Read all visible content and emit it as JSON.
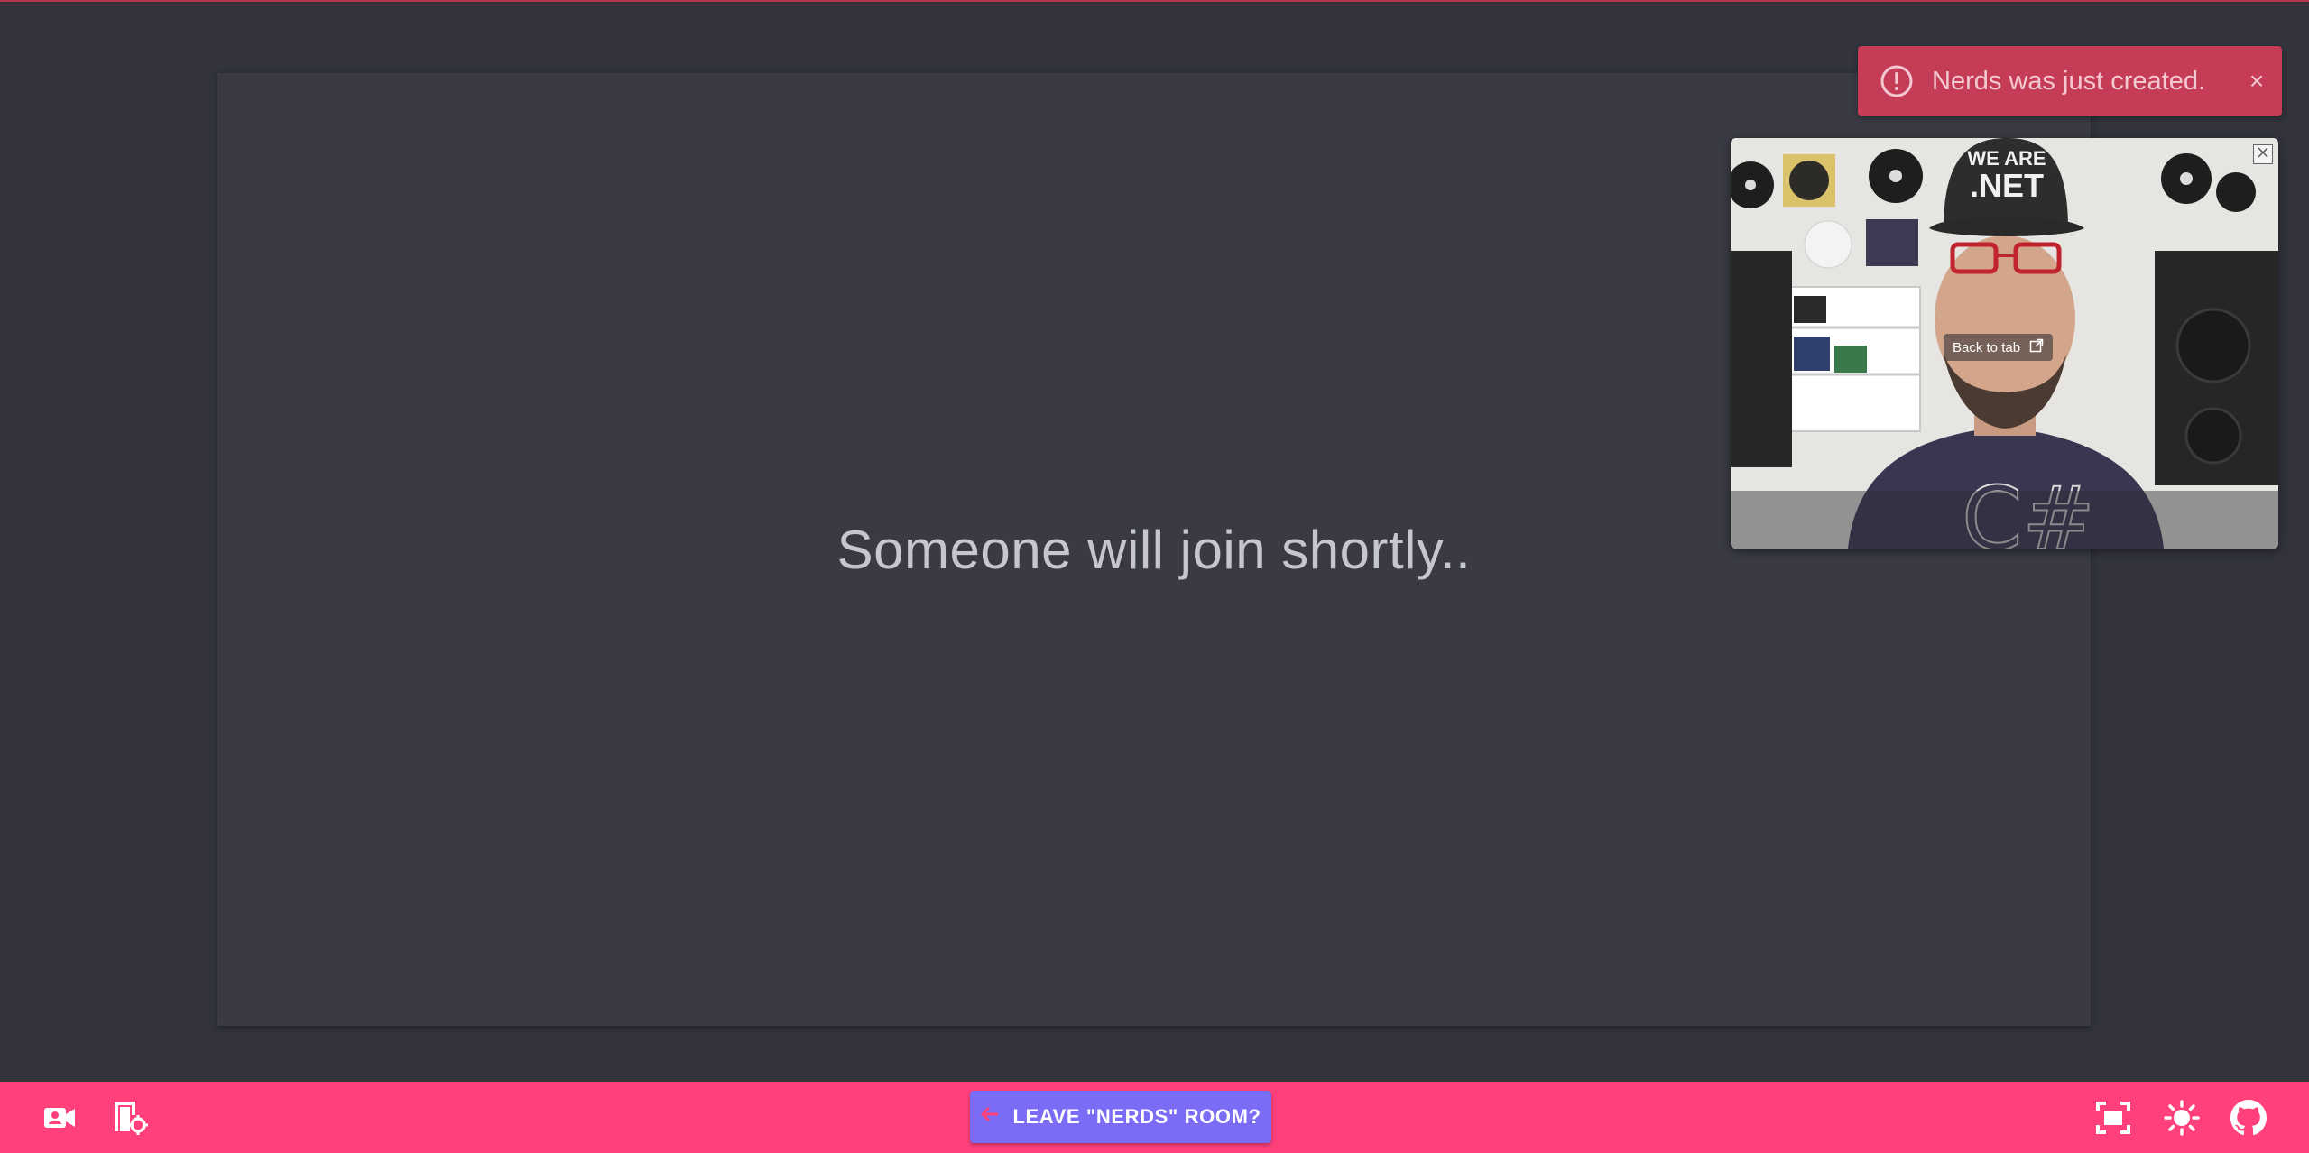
{
  "stage": {
    "waiting_message": "Someone will join shortly.."
  },
  "toast": {
    "message": "Nerds was just created.",
    "close_glyph": "×",
    "icon": "alert-circle-icon"
  },
  "pip": {
    "back_to_tab_label": "Back to tab",
    "hat_text": "WE ARE .NET",
    "shirt_text": "C#"
  },
  "bottom_bar": {
    "leave_button_label": "LEAVE \"NERDS\" ROOM?",
    "left_icons": [
      "video-settings-icon",
      "room-settings-icon"
    ],
    "right_icons": [
      "fullscreen-icon",
      "brightness-icon",
      "github-icon"
    ]
  },
  "colors": {
    "background": "#32333b",
    "stage": "#393a43",
    "toast": "#c53c56",
    "bottom_bar": "#ff407b",
    "leave_button": "#7b6cf5"
  }
}
